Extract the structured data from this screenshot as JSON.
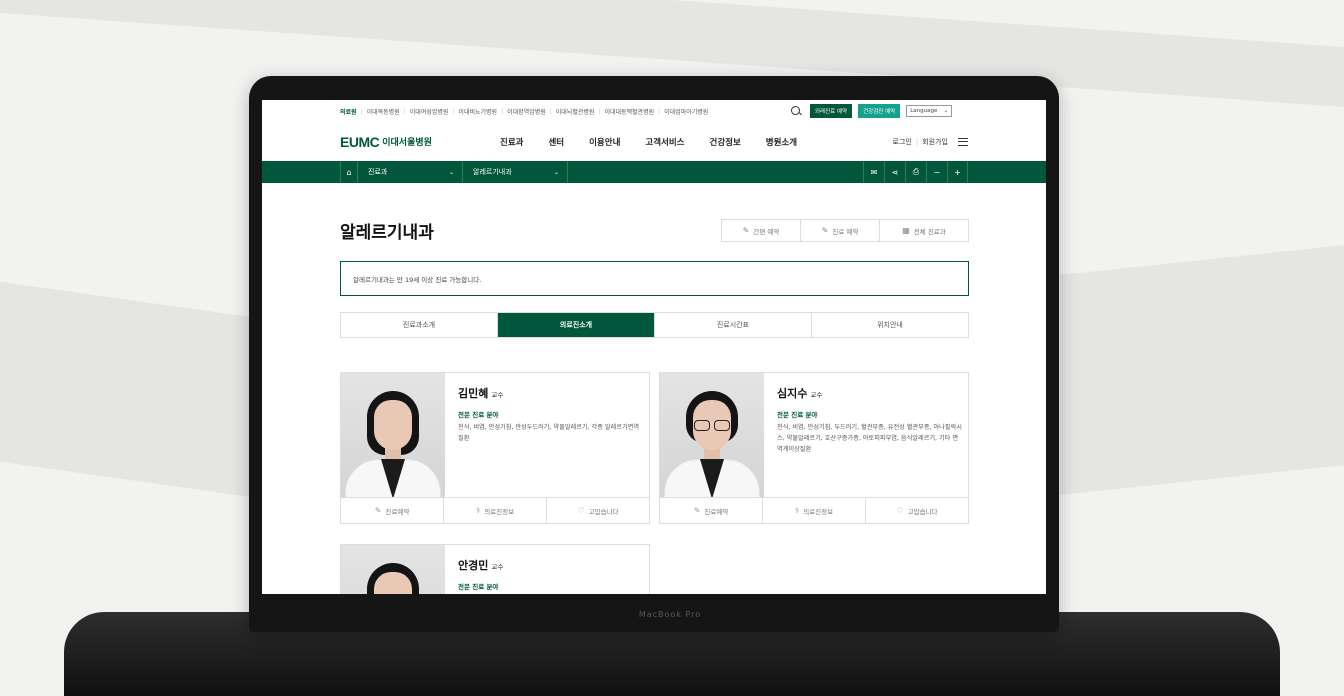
{
  "topbar": {
    "sites": [
      "의료원",
      "이대목동병원",
      "이대여성암병원",
      "이대비뇨기병원",
      "이대함역암병원",
      "이대뇌혈관병원",
      "이대대동맥혈관병원",
      "이대엄마아기병원"
    ],
    "btn_foreign": "외래진료 예약",
    "btn_checkup": "건강검진 예약",
    "language": "Language"
  },
  "header": {
    "logo_mark": "EUMC",
    "logo_name": "이대서울병원",
    "gnb": [
      "진료과",
      "센터",
      "이용안내",
      "고객서비스",
      "건강정보",
      "병원소개"
    ],
    "login": "로그인",
    "join": "회원가입"
  },
  "location": {
    "depth1": "진료과",
    "depth2": "알레르기내과"
  },
  "page": {
    "title": "알레르기내과",
    "quick": [
      "간편 예약",
      "진료 예약",
      "전체 진료과"
    ],
    "notice": "알레르기내과는 만 19세 이상 진료 가능합니다.",
    "tabs": [
      "진료과소개",
      "의료진소개",
      "진료시간표",
      "위치안내"
    ],
    "active_tab": "의료진소개"
  },
  "doctors": [
    {
      "name": "김민혜",
      "title": "교수",
      "spec_label": "전문 진료 분야",
      "spec": "천식, 비염, 만성기침, 만성두드러기, 약물알레르기, 각종 알레르기면역질환"
    },
    {
      "name": "심지수",
      "title": "교수",
      "spec_label": "전문 진료 분야",
      "spec": "천식, 비염, 만성기침, 두드러기, 혈관부종, 유전성 혈관부종, 아나필락시스, 약물알레르기, 호산구증가증, 아토피피부염, 음식알레르기, 기타 면역계이상질환"
    },
    {
      "name": "안경민",
      "title": "교수",
      "spec_label": "전문 진료 분야",
      "spec": ""
    }
  ],
  "card_actions": [
    "진료예약",
    "의료진정보",
    "고맙습니다"
  ],
  "laptop_label": "MacBook Pro",
  "colors": {
    "brand": "#00573b",
    "teal": "#14a18e"
  }
}
